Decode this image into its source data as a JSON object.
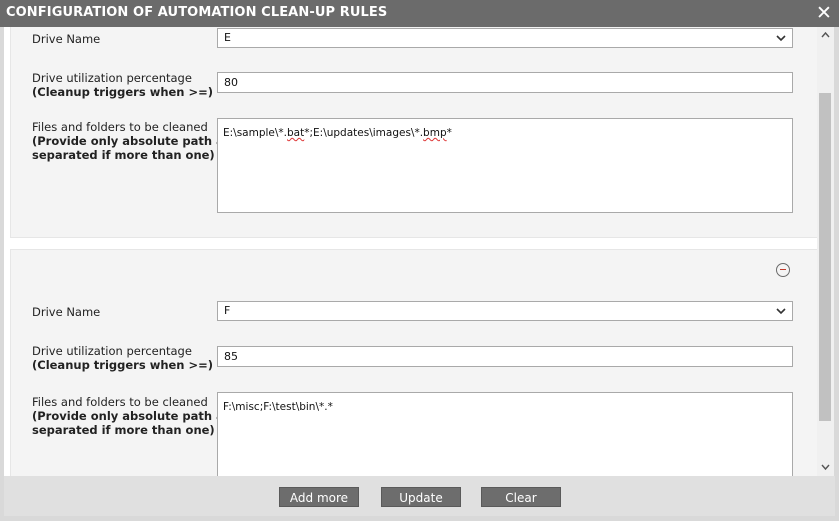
{
  "dialog": {
    "title": "CONFIGURATION OF AUTOMATION CLEAN-UP RULES",
    "close_glyph": "✕"
  },
  "labels": {
    "drive_name": "Drive Name",
    "utilization": "Drive utilization percentage",
    "utilization_note": "(Cleanup triggers when >=)",
    "files": "Files and folders to be cleaned",
    "files_note_1": "(Provide only absolute path and ;",
    "files_note_2": "separated if more than one)"
  },
  "rules": [
    {
      "drive": "E",
      "utilization": "80",
      "paths_parts": [
        "E:\\sample\\*.",
        "bat",
        "*;E:\\updates\\images\\*.",
        "bmp",
        "*"
      ]
    },
    {
      "drive": "F",
      "utilization": "85",
      "paths": "F:\\misc;F:\\test\\bin\\*.*"
    }
  ],
  "footer": {
    "add_more": "Add more",
    "update": "Update",
    "clear": "Clear"
  },
  "colors": {
    "titlebar": "#6b6b6b",
    "button": "#6d6d6d",
    "remove_icon": "#c0392b",
    "spellcheck_underline": "#dd3333"
  }
}
